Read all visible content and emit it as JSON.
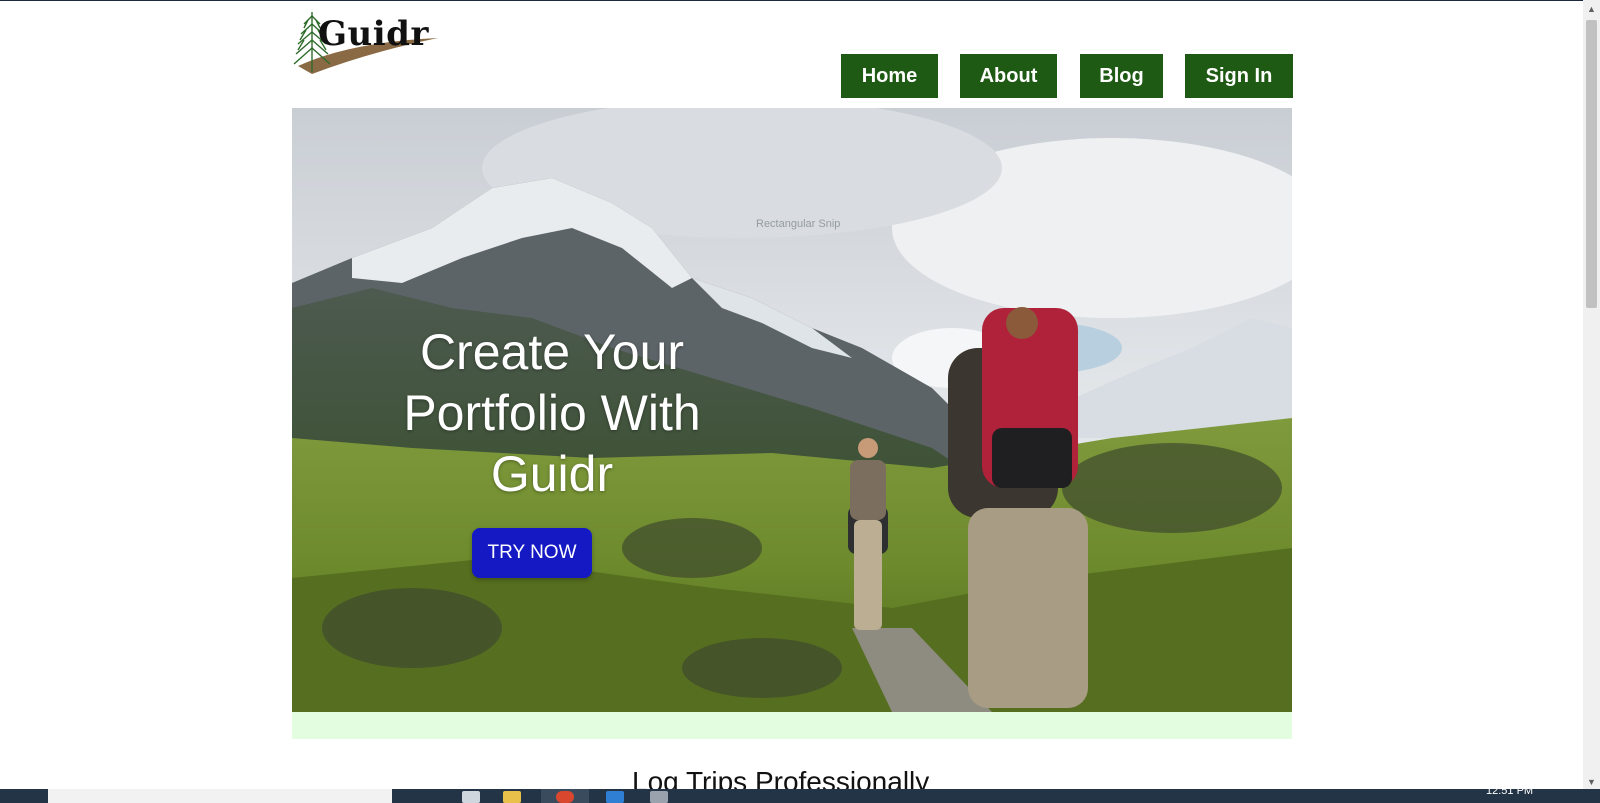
{
  "brand": {
    "name": "Guidr",
    "logo_icon": "pine-tree-icon"
  },
  "nav": {
    "items": [
      {
        "label": "Home"
      },
      {
        "label": "About"
      },
      {
        "label": "Blog"
      },
      {
        "label": "Sign In"
      }
    ]
  },
  "hero": {
    "heading_lines": [
      "Create Your",
      "Portfolio With",
      "Guidr"
    ],
    "cta_label": "TRY NOW",
    "image": "mountain-hikers-photo",
    "tooltip": "Rectangular Snip"
  },
  "section": {
    "heading": "Log Trips Professionally"
  },
  "taskbar": {
    "clock": "12:51 PM"
  },
  "colors": {
    "nav_bg": "#1f5a14",
    "cta_bg": "#1419c4",
    "band_bg": "#e3fde0",
    "taskbar_bg": "#243447"
  }
}
